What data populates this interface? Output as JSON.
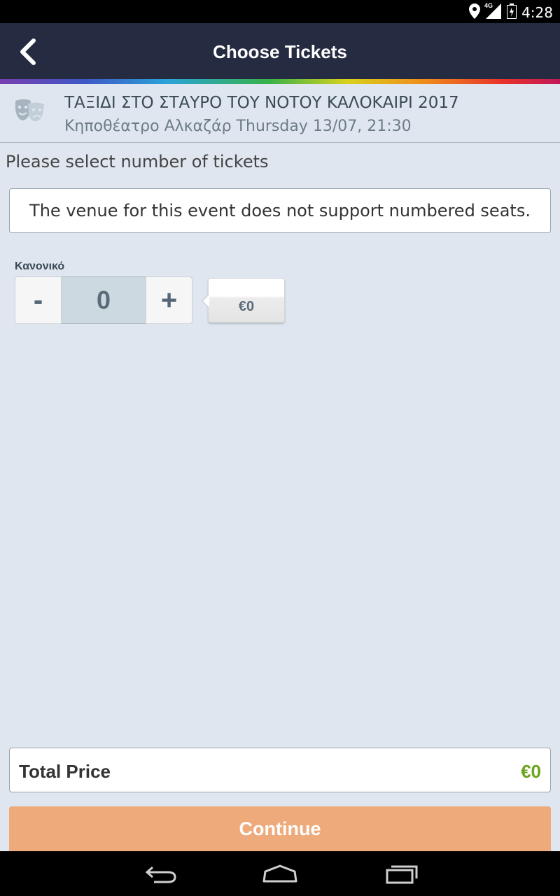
{
  "status_bar": {
    "time": "4:28",
    "network": "4G"
  },
  "app_bar": {
    "title": "Choose Tickets"
  },
  "event": {
    "title": "ΤΑΞΙΔΙ ΣΤΟ ΣΤΑΥΡΟ ΤΟΥ ΝΟΤΟΥ ΚΑΛΟΚΑΙΡΙ 2017",
    "subtitle": "Κηποθέατρο Αλκαζάρ Thursday 13/07, 21:30",
    "icon": "theater-masks-icon"
  },
  "main": {
    "prompt": "Please select number of tickets",
    "notice": "The venue for this event does not support numbered seats."
  },
  "ticket": {
    "type_label": "Κανονικό",
    "minus_label": "-",
    "quantity": "0",
    "plus_label": "+",
    "price": "€0"
  },
  "total": {
    "label": "Total Price",
    "value": "€0"
  },
  "actions": {
    "continue_label": "Continue"
  },
  "colors": {
    "app_bar": "#252c41",
    "background": "#dfe6ef",
    "continue_button": "#eeaa7b",
    "total_value": "#6aa31c"
  }
}
